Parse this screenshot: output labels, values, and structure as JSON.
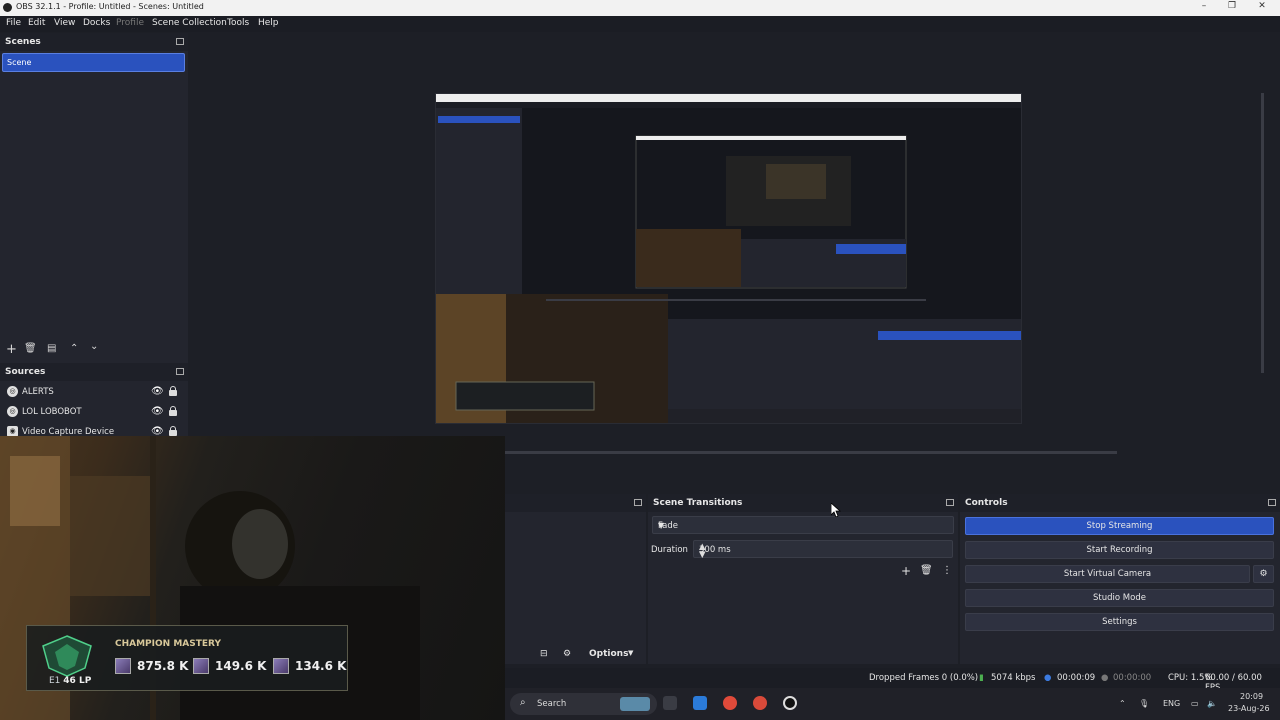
{
  "window": {
    "title": "OBS 32.1.1 - Profile: Untitled - Scenes: Untitled",
    "minimize": "–",
    "maximize": "❐",
    "close": "✕"
  },
  "menu": [
    "File",
    "Edit",
    "View",
    "Docks",
    "Profile",
    "Scene Collection",
    "Tools",
    "Help"
  ],
  "scenes": {
    "title": "Scenes",
    "items": [
      "Scene"
    ],
    "toolbar": [
      "+",
      "🗑",
      "▤",
      "⌃",
      "⌄"
    ]
  },
  "sources": {
    "title": "Sources",
    "items": [
      {
        "label": "ALERTS",
        "icon": "globe-icon"
      },
      {
        "label": "LOL LOBOBOT",
        "icon": "globe-icon"
      },
      {
        "label": "Video Capture Device",
        "icon": "camera-icon"
      }
    ]
  },
  "overlay": {
    "title": "CHAMPION MASTERY",
    "rank": "E1",
    "lp": "46 LP",
    "stats": [
      "875.8 K",
      "149.6 K",
      "134.6 K"
    ]
  },
  "mixer": {
    "options_label": "Options"
  },
  "scene_transitions": {
    "title": "Scene Transitions",
    "transition": "Fade",
    "duration_label": "Duration",
    "duration_value": "300 ms"
  },
  "controls": {
    "title": "Controls",
    "buttons": [
      "Stop Streaming",
      "Start Recording",
      "Start Virtual Camera",
      "Studio Mode",
      "Settings"
    ]
  },
  "status": {
    "dropped_frames": "Dropped Frames 0 (0.0%)",
    "bitrate": "5074 kbps",
    "stream_time": "00:00:09",
    "record_time": "00:00:00",
    "cpu": "CPU: 1.5%",
    "fps": "60.00 / 60.00 FPS"
  },
  "taskbar": {
    "search_placeholder": "Search",
    "language": "ENG",
    "time": "20:09",
    "date": "23-Aug-26"
  },
  "colors": {
    "accent": "#2a52be",
    "panel": "#23252e",
    "background": "#1d1f26"
  }
}
